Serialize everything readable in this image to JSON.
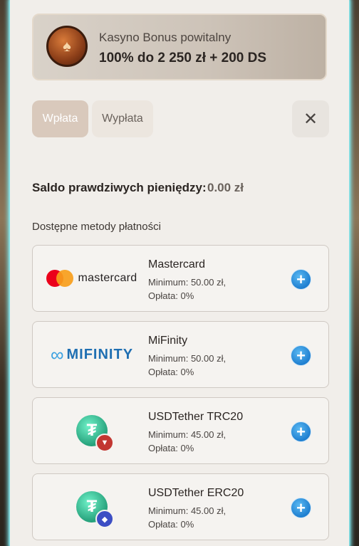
{
  "bonus": {
    "title": "Kasyno Bonus powitalny",
    "offer": "100% do 2 250 zł + 200 DS"
  },
  "tabs": {
    "deposit": "Wpłata",
    "withdraw": "Wypłata",
    "active": "deposit"
  },
  "close_symbol": "✕",
  "balance": {
    "label": "Saldo prawdziwych pieniędzy:",
    "value": "0.00 zł"
  },
  "methods_title": "Dostępne metody płatności",
  "methods": [
    {
      "name": "Mastercard",
      "minimum": "Minimum: 50.00 zł,",
      "fee": "Opłata: 0%",
      "logo_text": "mastercard",
      "icon": "mastercard-logo"
    },
    {
      "name": "MiFinity",
      "minimum": "Minimum: 50.00 zł,",
      "fee": "Opłata: 0%",
      "logo_text": "MIFINITY",
      "icon": "mifinity-logo"
    },
    {
      "name": "USDTether TRC20",
      "minimum": "Minimum: 45.00 zł,",
      "fee": "Opłata: 0%",
      "icon": "tether-trc20-icon"
    },
    {
      "name": "USDTether ERC20",
      "minimum": "Minimum: 45.00 zł,",
      "fee": "Opłata: 0%",
      "icon": "tether-erc20-icon"
    }
  ],
  "colors": {
    "accent_blue": "#1f7fd0",
    "tether_green": "#26a17b",
    "panel_glow": "#7fe9f0"
  }
}
